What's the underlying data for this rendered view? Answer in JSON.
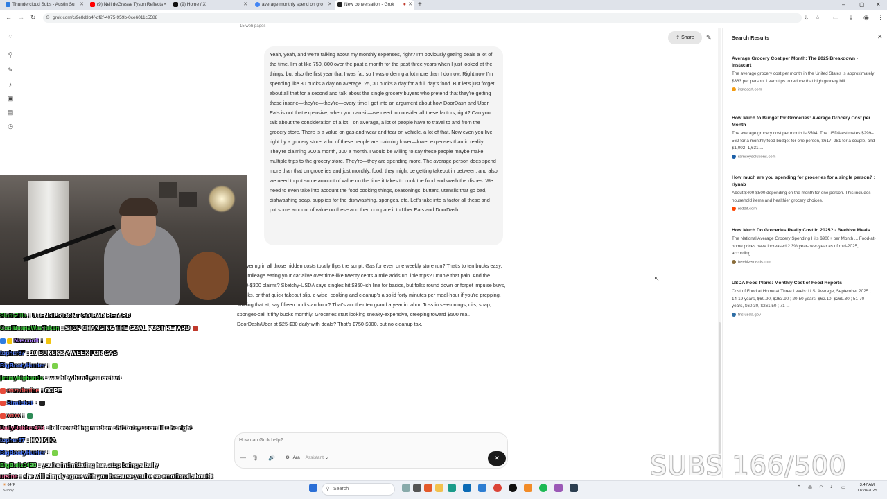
{
  "browser": {
    "tabs": [
      {
        "title": "Thundercloud Subs - Austin Su",
        "color": "#2f7de1"
      },
      {
        "title": "(9) Neil deGrasse Tyson Reflects",
        "color": "#ff0000"
      },
      {
        "title": "(9) Home / X",
        "color": "#111111"
      },
      {
        "title": "average monthly spend on gro",
        "color": "#4285f4"
      },
      {
        "title": "New conversation - Grok",
        "color": "#222222"
      }
    ],
    "url": "grok.com/c/9e8d3b4f-df2f-4075-959b-0ce6011c5588",
    "new_tab": "+"
  },
  "chat": {
    "web_pages_label": "15 web pages",
    "share_label": "Share",
    "user_message": "Yeah, yeah, and we're talking about my monthly expenses, right? I'm obviously getting deals a lot of the time. I'm at like 750, 800 over the past a month for the past three years when I just looked at the things, but also the first year that I was fat, so I was ordering a lot more than I do now. Right now I'm spending like 30 bucks a day on average, 25, 30 bucks a day for a full day's food. But let's just forget about all that for a second and talk about the single grocery buyers who pretend that they're getting these insane—they're—they're—every time I get into an argument about how DoorDash and Uber Eats is not that expensive, when you can sit—we need to consider all these factors, right? Can you talk about the consideration of a lot—on average, a lot of people have to travel to and from the grocery store. There is a value on gas and wear and tear on vehicle, a lot of that. Now even you live right by a grocery store, a lot of these people are claiming lower—lower expenses than in reality. They're claiming 200 a month, 300 a month. I would be willing to say these people maybe make multiple trips to the grocery store. They're—they are spending more. The average person does spend more than that on groceries and just monthly. food, they might be getting takeout in between, and also we need to put some amount of value on the time it takes to cook the food and wash the dishes. We need to even take into account the food cooking things, seasonings, butters, utensils that go bad, dishwashing soap, supplies for the dishwashing, sponges, etc. Let's take into a factor all these and put some amount of value on these and then compare it to Uber Eats and DoorDash.",
    "grok_message": "h, layering in all those hidden costs totally flips the script. Gas for even one weekly store run? That's to ten bucks easy, plus mileage eating your car alive over time-like twenty cents a mile adds up. iple trips? Double that pain. And the $200-$300 claims? Sketchy-USDA says singles hit $350-ish line for basics, but folks round down or forget impulse buys, snacks, or that quick takeout slip. e-wise, cooking and cleanup's a solid forty minutes per meal-hour if you're prepping. Valuing that at, say fifteen bucks an hour? That's another ten grand a year in labor. Toss in seasonings, oils, soap, sponges-call it fifty bucks monthly. Groceries start looking sneaky-expensive, creeping toward $500 real. DoorDash/Uber at $25-$30 daily with deals? That's $750-$900, but no cleanup tax.",
    "composer_placeholder": "How can Grok help?",
    "voice_label": "Ara",
    "mode_label": "Assistant",
    "send_icon": "close-icon"
  },
  "search_results": {
    "title": "Search Results",
    "items": [
      {
        "heading": "Average Grocery Cost per Month: The 2025 Breakdown - Instacart",
        "desc": "The average grocery cost per month in the United States is approximately $363 per person. Learn tips to reduce that high grocery bill.",
        "source": "instacart.com",
        "color": "#f39c12"
      },
      {
        "heading": "How Much to Budget for Groceries: Average Grocery Cost per Month",
        "desc": "The average grocery cost per month is $504. The USDA estimates $299–569 for a monthly food budget for one person, $617–981 for a couple, and $1,002–1,631 ...",
        "source": "ramseysolutions.com",
        "color": "#1b5fa8"
      },
      {
        "heading": "How much are you spending for groceries for a single person? : r/ynab",
        "desc": "About $400-$500 depending on the month for one person. This includes household items and healthier grocery choices.",
        "source": "reddit.com",
        "color": "#ff4500"
      },
      {
        "heading": "How Much Do Groceries Really Cost in 2025? - Beehive Meals",
        "desc": "The National Average Grocery Spending Hits $900+ per Month ... Food-at-home prices have increased 2.3% year-over-year as of mid-2025, according ...",
        "source": "beehivemeals.com",
        "color": "#8a6d3b"
      },
      {
        "heading": "USDA Food Plans: Monthly Cost of Food Reports",
        "desc": "Cost of Food at Home at Three Levels: U.S. Average, September 2025 ; 14-19 years, $60.90, $263.90 ; 20-50 years, $62.10, $269.30 ; 51-70 years, $60.30, $261.50 ; 71 ...",
        "source": "fns.usda.gov",
        "color": "#2e6da4"
      }
    ]
  },
  "stream_chat": [
    {
      "user": "SlothZilla",
      "text": ": UTENSILS DONT GO BAD RETARD",
      "color": "#3ec93e"
    },
    {
      "user": "CoolBeansWasTaken",
      "text": ": STOP CHANGING THE GOAL POST RETARD",
      "color": "#3ec93e"
    },
    {
      "user": "Nascoofi",
      "text": ":",
      "color": "#b080ff"
    },
    {
      "user": "topher87",
      "text": ": 10 BUKCKS A WEEK FOR GAS",
      "color": "#4f7dff"
    },
    {
      "user": "BigBootyHunter",
      "text": ":",
      "color": "#4f7dff"
    },
    {
      "user": "jimmybighands",
      "text": ": wash by hand you cretant",
      "color": "#3ec93e"
    },
    {
      "user": "enzadenine",
      "text": ": COPE",
      "color": "#ff6060"
    },
    {
      "user": "Strafebot",
      "text": ":",
      "color": "#4f7dff"
    },
    {
      "user": "xoxx",
      "text": ":",
      "color": "#ff6060"
    },
    {
      "user": "DailyDabber413",
      "text": ": lol bro adding random shit to try seem like he right",
      "color": "#ff7aa8"
    },
    {
      "user": "topher87",
      "text": ": HAHAHA",
      "color": "#4f7dff"
    },
    {
      "user": "BigBootyHunter",
      "text": ":",
      "color": "#4f7dff"
    },
    {
      "user": "BigBallz0420",
      "text": ": you're intimidating her. stop being a bully",
      "color": "#3ec93e"
    },
    {
      "user": "ursine",
      "text": ": she will simply agree with you because you're so emotional about it",
      "color": "#ff7aa8"
    }
  ],
  "overlay": {
    "subs": "SUBS 166/500"
  },
  "taskbar": {
    "search_label": "Search",
    "time": "3:47 AM",
    "date": "11/28/2025",
    "weather_temp": "64°F",
    "weather_cond": "Sunny"
  }
}
